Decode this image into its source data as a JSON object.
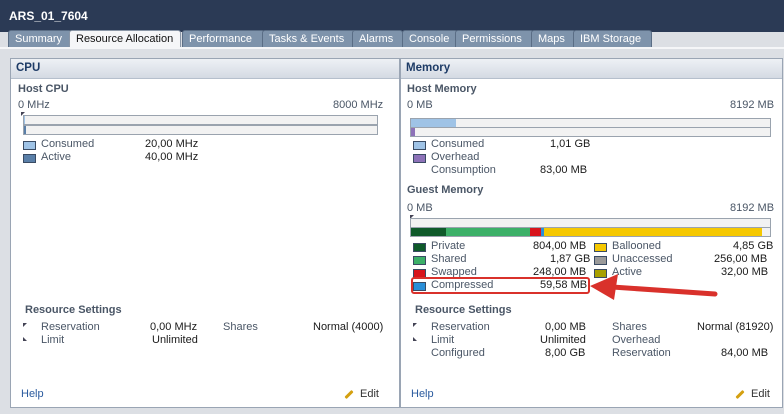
{
  "window": {
    "title": "ARS_01_7604"
  },
  "tabs": [
    "Summary",
    "Resource Allocation",
    "Performance",
    "Tasks & Events",
    "Alarms",
    "Console",
    "Permissions",
    "Maps",
    "IBM Storage"
  ],
  "colors": {
    "consumed": "#9fc3e6",
    "active": "#5a7fa8",
    "overhead": "#8d72b8",
    "private": "#0f5a2a",
    "shared": "#3cb068",
    "swapped": "#d8141b",
    "compressed": "#2a8fd8",
    "ballooned": "#f5c800",
    "unaccessed": "#9a9a9a",
    "guest_active": "#a8a000"
  },
  "cpu": {
    "header": "CPU",
    "host_title": "Host CPU",
    "scale_min": "0 MHz",
    "scale_max": "8000 MHz",
    "consumed_label": "Consumed",
    "consumed_value": "20,00 MHz",
    "active_label": "Active",
    "active_value": "40,00 MHz",
    "consumed_fraction": 0.0025,
    "active_fraction": 0.005,
    "rs_title": "Resource Settings",
    "reservation_label": "Reservation",
    "reservation_value": "0,00 MHz",
    "limit_label": "Limit",
    "limit_value": "Unlimited",
    "shares_label": "Shares",
    "shares_value": "Normal (4000)",
    "help": "Help",
    "edit": "Edit"
  },
  "memory": {
    "header": "Memory",
    "host_title": "Host Memory",
    "scale_min": "0 MB",
    "scale_max": "8192 MB",
    "consumed_label": "Consumed",
    "consumed_value": "1,01 GB",
    "overhead_label1": "Overhead",
    "overhead_label2": "Consumption",
    "overhead_value": "83,00 MB",
    "host_consumed_fraction": 0.126,
    "host_overhead_fraction": 0.0101,
    "guest_title": "Guest Memory",
    "guest_min": "0 MB",
    "guest_max": "8192 MB",
    "private_label": "Private",
    "private_value": "804,00 MB",
    "shared_label": "Shared",
    "shared_value": "1,87 GB",
    "swapped_label": "Swapped",
    "swapped_value": "248,00 MB",
    "compressed_label": "Compressed",
    "compressed_value": "59,58 MB",
    "ballooned_label": "Ballooned",
    "ballooned_value": "4,85 GB",
    "unaccessed_label": "Unaccessed",
    "unaccessed_value": "256,00 MB",
    "active_label": "Active",
    "active_value": "32,00 MB",
    "guest_private_mb": 804,
    "guest_shared_mb": 1915,
    "guest_swapped_mb": 248,
    "guest_compressed_mb": 59.58,
    "guest_ballooned_mb": 4966,
    "guest_unaccessed_mb": 256,
    "guest_active_mb": 32,
    "guest_total_mb": 8192,
    "rs_title": "Resource Settings",
    "reservation_label": "Reservation",
    "reservation_value": "0,00 MB",
    "limit_label": "Limit",
    "limit_value": "Unlimited",
    "configured_label": "Configured",
    "configured_value": "8,00 GB",
    "shares_label": "Shares",
    "shares_value": "Normal (81920)",
    "overhead_rs_label": "Overhead",
    "oreservation_label": "Reservation",
    "oreservation_value": "84,00 MB",
    "help": "Help",
    "edit": "Edit"
  }
}
